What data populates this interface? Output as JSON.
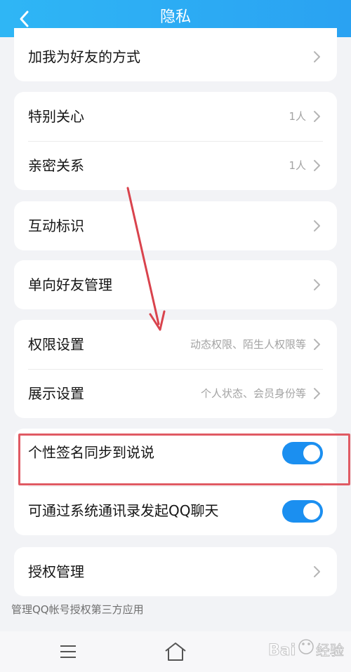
{
  "header": {
    "title": "隐私",
    "back_icon": "chevron-left-icon"
  },
  "rows": {
    "add_friend_method": {
      "label": "加我为好友的方式"
    },
    "special_care": {
      "label": "特别关心",
      "value": "1人"
    },
    "intimate": {
      "label": "亲密关系",
      "value": "1人"
    },
    "interaction_mark": {
      "label": "互动标识"
    },
    "one_way_friends": {
      "label": "单向好友管理"
    },
    "permission": {
      "label": "权限设置",
      "value": "动态权限、陌生人权限等"
    },
    "display": {
      "label": "展示设置",
      "value": "个人状态、会员身份等"
    },
    "signature_sync": {
      "label": "个性签名同步到说说",
      "enabled": true
    },
    "contacts_chat": {
      "label": "可通过系统通讯录发起QQ聊天",
      "enabled": true
    },
    "authorization": {
      "label": "授权管理"
    }
  },
  "footnote": "管理QQ帐号授权第三方应用",
  "navbar": {
    "menu_icon": "menu-icon",
    "home_icon": "home-icon"
  },
  "watermark": {
    "text": "Bai 经验"
  },
  "colors": {
    "header": "#2aa2f2",
    "toggle_on": "#1b8ff0",
    "highlight": "#e05a63",
    "arrow": "#d9434d"
  }
}
